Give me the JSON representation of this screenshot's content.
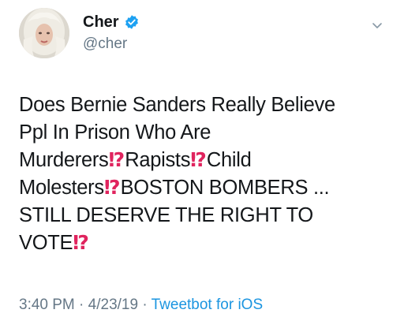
{
  "tweet": {
    "author": {
      "display_name": "Cher",
      "handle": "@cher",
      "verified": true
    },
    "text_lines": [
      [
        {
          "t": "Does Bernie Sanders Really Believe"
        }
      ],
      [
        {
          "t": "Ppl In Prison Who  Are"
        }
      ],
      [
        {
          "t": "Murderers"
        },
        {
          "e": "⁉"
        },
        {
          "t": "Rapists"
        },
        {
          "e": "⁉"
        },
        {
          "t": "Child"
        }
      ],
      [
        {
          "t": "Molesters"
        },
        {
          "e": "⁉"
        },
        {
          "t": "BOSTON BOMBERS ..."
        }
      ],
      [
        {
          "t": "STILL DESERVE THE RIGHT TO"
        }
      ],
      [
        {
          "t": "VOTE"
        },
        {
          "e": "⁉"
        }
      ]
    ],
    "time": "3:40 PM",
    "date": "4/23/19",
    "separator": "·",
    "source": "Tweetbot for iOS",
    "colors": {
      "link": "#1b95e0",
      "verified": "#1da1f2",
      "interrobang": "#e0245e",
      "muted": "#657786"
    },
    "icons": [
      "verified-badge-icon",
      "chevron-down-icon"
    ]
  }
}
